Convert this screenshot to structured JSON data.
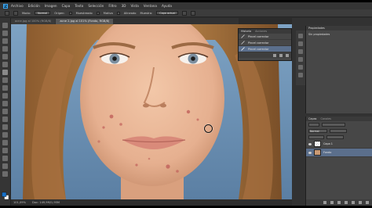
{
  "app": {
    "logo": "Ps"
  },
  "menu": [
    "Archivo",
    "Edición",
    "Imagen",
    "Capa",
    "Texto",
    "Selección",
    "Filtro",
    "3D",
    "Vista",
    "Ventana",
    "Ayuda"
  ],
  "options": {
    "mode_label": "Modo:",
    "mode_value": "Normal",
    "source_label": "Origen:",
    "sampled_label": "Muestreado",
    "pattern_label": "Motivo",
    "aligned_label": "Alineado",
    "sample_label": "Muestra:",
    "sample_value": "Capa actual"
  },
  "doc_tabs": [
    {
      "label": "acne.jpg al 100% (RGB/8)",
      "active": false
    },
    {
      "label": "acne 2.jpg al 101% (Fondo, RGB/8)",
      "active": true
    }
  ],
  "history": {
    "tabs": [
      "Historia",
      "Acciones"
    ],
    "items": [
      "Pincel corrector",
      "Pincel corrector",
      "Pincel corrector"
    ],
    "selected_index": 2
  },
  "properties": {
    "title": "Propiedades",
    "empty_text": "Sin propiedades"
  },
  "layers": {
    "tabs": [
      "Capas",
      "Canales"
    ],
    "mode_value": "Normal",
    "items": [
      {
        "name": "Capa 1",
        "selected": false
      },
      {
        "name": "Fondo",
        "selected": true
      }
    ]
  },
  "status": {
    "zoom": "101,09%",
    "doc": "Doc: 149,9M/1,95M"
  },
  "colors": {
    "accent": "#5b6f8c",
    "background": "#2b2b2b",
    "panel": "#474747"
  }
}
